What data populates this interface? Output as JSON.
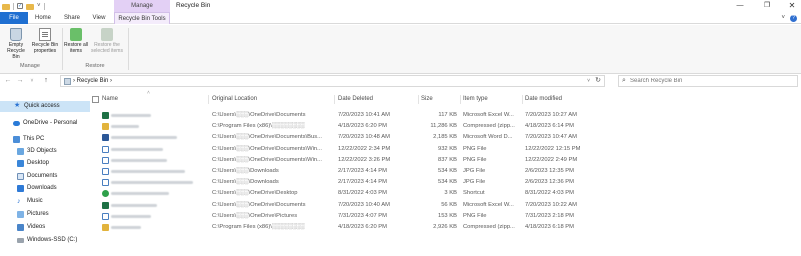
{
  "titlebar": {
    "manage_label": "Manage",
    "window_title": "Recycle Bin",
    "min_glyph": "—",
    "max_glyph": "❐",
    "close_glyph": "✕"
  },
  "tabs": {
    "file": "File",
    "home": "Home",
    "share": "Share",
    "view": "View",
    "recycle_bin_tools": "Recycle Bin Tools",
    "expand_glyph": "˅",
    "help_glyph": "?"
  },
  "ribbon": {
    "empty_bin": "Empty Recycle Bin",
    "bin_properties": "Recycle Bin properties",
    "restore_all": "Restore all items",
    "restore_selected": "Restore the selected items",
    "group_manage": "Manage",
    "group_restore": "Restore"
  },
  "address": {
    "back_glyph": "←",
    "forward_glyph": "→",
    "recent_glyph": "˅",
    "up_glyph": "↑",
    "breadcrumb": "›  Recycle Bin  ›",
    "dropdown_glyph": "˅",
    "refresh_glyph": "↻",
    "search_placeholder": "Search Recycle Bin",
    "search_glyph": "⌕"
  },
  "nav": {
    "quick_access": "Quick access",
    "onedrive": "OneDrive - Personal",
    "this_pc": "This PC",
    "objects3d": "3D Objects",
    "desktop": "Desktop",
    "documents": "Documents",
    "downloads": "Downloads",
    "music": "Music",
    "pictures": "Pictures",
    "videos": "Videos",
    "drive": "Windows-SSD (C:)"
  },
  "columns": {
    "name": "Name",
    "original_location": "Original Location",
    "date_deleted": "Date Deleted",
    "size": "Size",
    "item_type": "Item type",
    "date_modified": "Date modified"
  },
  "rows": [
    {
      "icon": "excel",
      "loc": "C:\\Users\\░░░\\OneDrive\\Documents",
      "deleted": "7/20/2023 10:41 AM",
      "size": "117 KB",
      "type": "Microsoft Excel W...",
      "modified": "7/20/2023 10:27 AM"
    },
    {
      "icon": "zip",
      "loc": "C:\\Program Files (x86)\\░░░░░░░░",
      "deleted": "4/18/2023 6:20 PM",
      "size": "11,286 KB",
      "type": "Compressed (zipp...",
      "modified": "4/18/2023 6:14 PM"
    },
    {
      "icon": "word",
      "loc": "C:\\Users\\░░░\\OneDrive\\Documents\\Bus...",
      "deleted": "7/20/2023 10:48 AM",
      "size": "2,185 KB",
      "type": "Microsoft Word D...",
      "modified": "7/20/2023 10:47 AM"
    },
    {
      "icon": "png",
      "loc": "C:\\Users\\░░░\\OneDrive\\Documents\\Win...",
      "deleted": "12/22/2022 2:34 PM",
      "size": "932 KB",
      "type": "PNG File",
      "modified": "12/22/2022 12:15 PM"
    },
    {
      "icon": "png",
      "loc": "C:\\Users\\░░░\\OneDrive\\Documents\\Win...",
      "deleted": "12/22/2022 3:26 PM",
      "size": "837 KB",
      "type": "PNG File",
      "modified": "12/22/2022 2:49 PM"
    },
    {
      "icon": "jpg",
      "loc": "C:\\Users\\░░░\\Downloads",
      "deleted": "2/17/2023 4:14 PM",
      "size": "534 KB",
      "type": "JPG File",
      "modified": "2/6/2023 12:35 PM"
    },
    {
      "icon": "jpg",
      "loc": "C:\\Users\\░░░\\Downloads",
      "deleted": "2/17/2023 4:14 PM",
      "size": "534 KB",
      "type": "JPG File",
      "modified": "2/6/2023 12:36 PM"
    },
    {
      "icon": "shortcut",
      "loc": "C:\\Users\\░░░\\OneDrive\\Desktop",
      "deleted": "8/31/2022 4:03 PM",
      "size": "3 KB",
      "type": "Shortcut",
      "modified": "8/31/2022 4:03 PM"
    },
    {
      "icon": "excel",
      "loc": "C:\\Users\\░░░\\OneDrive\\Documents",
      "deleted": "7/20/2023 10:40 AM",
      "size": "56 KB",
      "type": "Microsoft Excel W...",
      "modified": "7/20/2023 10:22 AM"
    },
    {
      "icon": "png",
      "loc": "C:\\Users\\░░░\\OneDrive\\Pictures",
      "deleted": "7/31/2023 4:07 PM",
      "size": "153 KB",
      "type": "PNG File",
      "modified": "7/31/2023 2:18 PM"
    },
    {
      "icon": "zip",
      "loc": "C:\\Program Files (x86)\\░░░░░░░░",
      "deleted": "4/18/2023 6:20 PM",
      "size": "2,926 KB",
      "type": "Compressed (zipp...",
      "modified": "4/18/2023 6:18 PM"
    }
  ]
}
